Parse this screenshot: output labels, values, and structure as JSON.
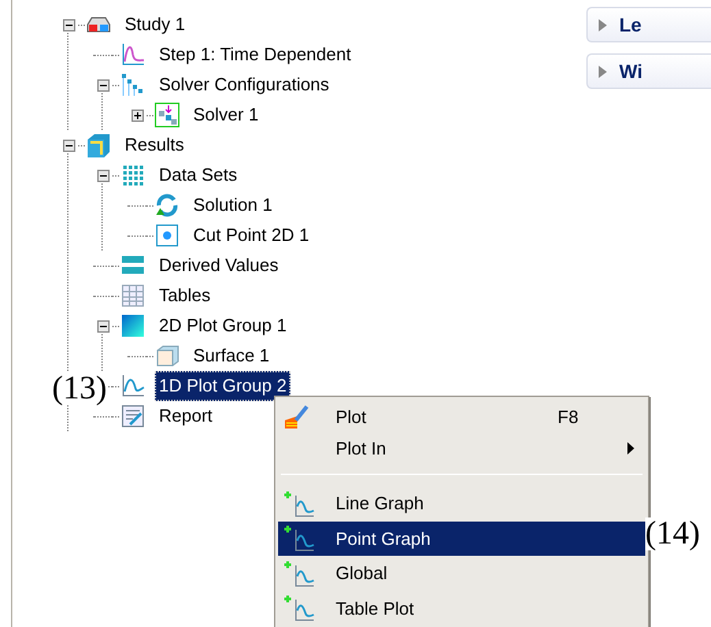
{
  "tree": [
    {
      "label": "Study 1",
      "kind": "study",
      "expanded": true,
      "selected": false,
      "children": [
        {
          "label": "Step 1: Time Dependent",
          "kind": "step",
          "selected": false
        },
        {
          "label": "Solver Configurations",
          "kind": "solver-configs",
          "expanded": true,
          "selected": false,
          "children": [
            {
              "label": "Solver 1",
              "kind": "solver",
              "expanded": false,
              "selected": false
            }
          ]
        }
      ]
    },
    {
      "label": "Results",
      "kind": "results",
      "expanded": true,
      "selected": false,
      "children": [
        {
          "label": "Data Sets",
          "kind": "datasets",
          "expanded": true,
          "selected": false,
          "children": [
            {
              "label": "Solution 1",
              "kind": "solution",
              "selected": false
            },
            {
              "label": "Cut Point 2D 1",
              "kind": "cutpoint",
              "selected": false
            }
          ]
        },
        {
          "label": "Derived Values",
          "kind": "derived",
          "selected": false
        },
        {
          "label": "Tables",
          "kind": "tables",
          "selected": false
        },
        {
          "label": "2D Plot Group 1",
          "kind": "plot2d",
          "expanded": true,
          "selected": false,
          "children": [
            {
              "label": "Surface 1",
              "kind": "surface",
              "selected": false
            }
          ]
        },
        {
          "label": "1D Plot Group 2",
          "kind": "plot1d",
          "selected": true
        },
        {
          "label": "Report",
          "kind": "report",
          "selected": false
        }
      ]
    }
  ],
  "right_panel": {
    "sections": [
      {
        "label": "Le",
        "expanded": false
      },
      {
        "label": "Wi",
        "expanded": false
      }
    ]
  },
  "context_menu": [
    {
      "kind": "command",
      "label": "Plot",
      "shortcut": "F8",
      "selected": false
    },
    {
      "kind": "submenu",
      "label": "Plot In",
      "selected": false
    },
    {
      "kind": "separator"
    },
    {
      "kind": "add",
      "label": "Line Graph",
      "selected": false
    },
    {
      "kind": "add",
      "label": "Point Graph",
      "selected": true
    },
    {
      "kind": "add",
      "label": "Global",
      "selected": false
    },
    {
      "kind": "add",
      "label": "Table Plot",
      "selected": false
    }
  ],
  "annotations": [
    {
      "label": "(13)"
    },
    {
      "label": "(14)"
    }
  ]
}
